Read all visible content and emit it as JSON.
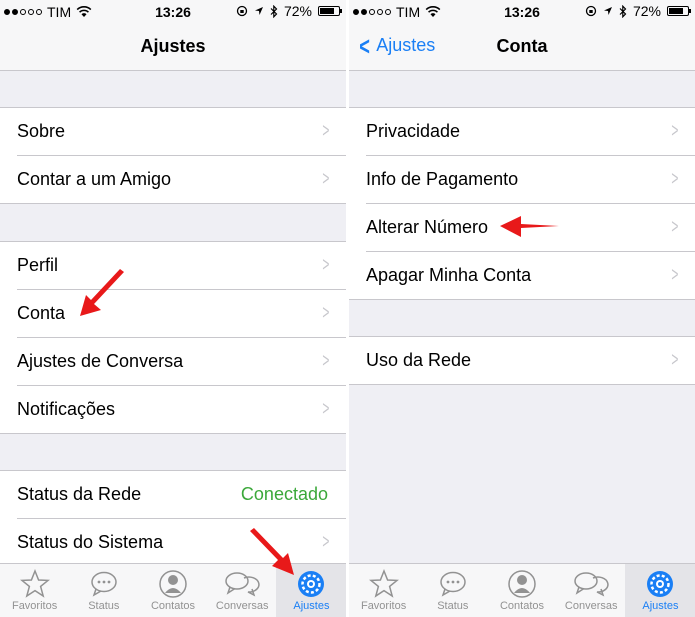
{
  "status_bar": {
    "carrier": "TIM",
    "time": "13:26",
    "battery": "72%"
  },
  "left_screen": {
    "title": "Ajustes",
    "group1": [
      "Sobre",
      "Contar a um Amigo"
    ],
    "group2": [
      "Perfil",
      "Conta",
      "Ajustes de Conversa",
      "Notificações"
    ],
    "group3": {
      "status_rede_label": "Status da Rede",
      "status_rede_value": "Conectado",
      "status_sistema_label": "Status do Sistema"
    }
  },
  "right_screen": {
    "back_label": "Ajustes",
    "title": "Conta",
    "group1": [
      "Privacidade",
      "Info de Pagamento",
      "Alterar Número",
      "Apagar Minha Conta"
    ],
    "group2": [
      "Uso da Rede"
    ]
  },
  "tab_bar": {
    "tabs": [
      "Favoritos",
      "Status",
      "Contatos",
      "Conversas",
      "Ajustes"
    ],
    "active": "Ajustes",
    "icons": [
      "star-icon",
      "chat-bubble-icon",
      "contact-icon",
      "conversations-icon",
      "gear-icon"
    ]
  },
  "colors": {
    "accent": "#1a7ff5",
    "connected": "#3ba83a",
    "arrow": "#e8191a",
    "background": "#efeff4"
  }
}
